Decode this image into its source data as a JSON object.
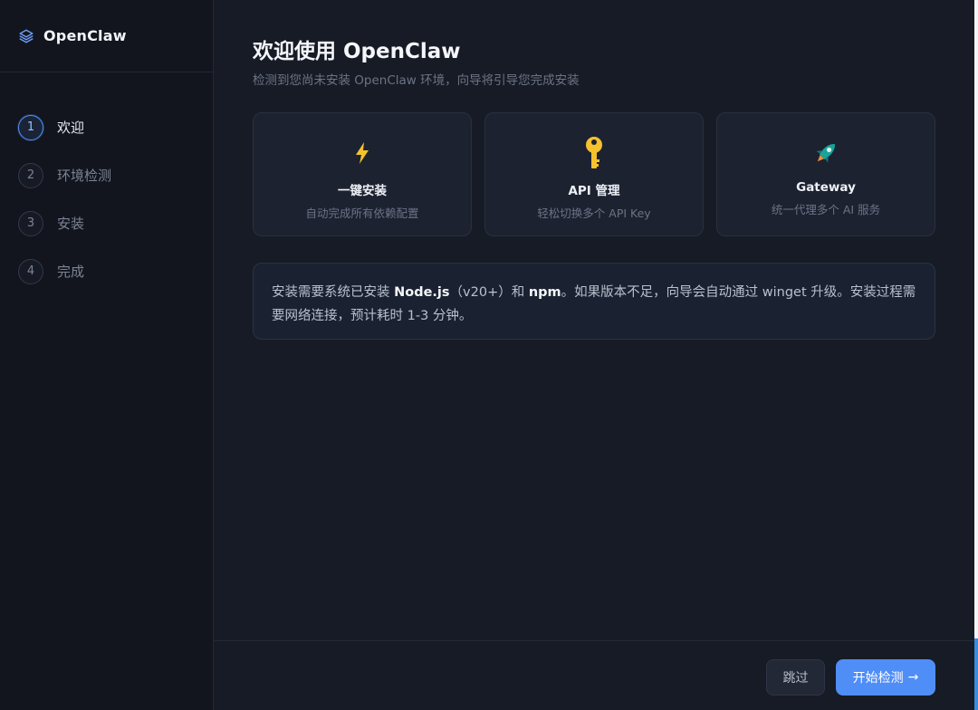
{
  "brand": {
    "name": "OpenClaw",
    "icon": "layers-icon",
    "accent": "#4f8ef7"
  },
  "steps": [
    {
      "num": "1",
      "label": "欢迎",
      "active": true
    },
    {
      "num": "2",
      "label": "环境检测",
      "active": false
    },
    {
      "num": "3",
      "label": "安装",
      "active": false
    },
    {
      "num": "4",
      "label": "完成",
      "active": false
    }
  ],
  "main": {
    "title": "欢迎使用 OpenClaw",
    "subtitle": "检测到您尚未安装 OpenClaw 环境，向导将引导您完成安装",
    "cards": [
      {
        "icon": "lightning-icon",
        "title": "一键安装",
        "desc": "自动完成所有依赖配置"
      },
      {
        "icon": "key-icon",
        "title": "API 管理",
        "desc": "轻松切换多个 API Key"
      },
      {
        "icon": "rocket-icon",
        "title": "Gateway",
        "desc": "统一代理多个 AI 服务"
      }
    ],
    "notice": {
      "t1": "安装需要系统已安装 ",
      "node": "Node.js",
      "t2": "（v20+）和 ",
      "npm": "npm",
      "t3": "。如果版本不足，向导会自动通过 winget 升级。安装过程需要网络连接，预计耗时 1-3 分钟。"
    }
  },
  "footer": {
    "skip_label": "跳过",
    "start_label": "开始检测",
    "start_arrow": "→"
  }
}
